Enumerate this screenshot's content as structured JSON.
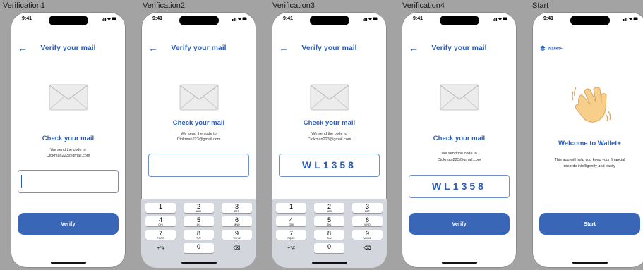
{
  "frames": [
    {
      "label": "Verification1",
      "time": "9:41",
      "nav_title": "Verify your mail",
      "check_title": "Check your mail",
      "sub_line1": "We send the code to",
      "sub_line2": "Ctokman223@gmail.com",
      "code_value": "",
      "button": "Verify"
    },
    {
      "label": "Verification2",
      "time": "9:41",
      "nav_title": "Verify your mail",
      "check_title": "Check your mail",
      "sub_line1": "We send the code to",
      "sub_line2": "Ctokman223@gmail.com",
      "code_value": ""
    },
    {
      "label": "Verification3",
      "time": "9:41",
      "nav_title": "Verify your mail",
      "check_title": "Check your mail",
      "sub_line1": "We send the code to",
      "sub_line2": "Ctokman223@gmail.com",
      "code_value": "WL1358"
    },
    {
      "label": "Verification4",
      "time": "9:41",
      "nav_title": "Verify your mail",
      "check_title": "Check your mail",
      "sub_line1": "We send the code to",
      "sub_line2": "Ctokman223@gmail.com",
      "code_value": "WL1358",
      "button": "Verify"
    },
    {
      "label": "Start",
      "time": "9:41",
      "brand": "Wallet+",
      "welcome_title": "Welcome to Wallet+",
      "welcome_line1": "This app will help you keep your financial",
      "welcome_line2": "records intelligently and easily",
      "button": "Start"
    }
  ],
  "keypad": {
    "keys": [
      {
        "digit": "1",
        "letters": ""
      },
      {
        "digit": "2",
        "letters": "ABC"
      },
      {
        "digit": "3",
        "letters": "DEF"
      },
      {
        "digit": "4",
        "letters": "GHI"
      },
      {
        "digit": "5",
        "letters": "JKL"
      },
      {
        "digit": "6",
        "letters": "MNO"
      },
      {
        "digit": "7",
        "letters": "PQRS"
      },
      {
        "digit": "8",
        "letters": "TUV"
      },
      {
        "digit": "9",
        "letters": "WXYZ"
      },
      {
        "digit": "+*#",
        "letters": ""
      },
      {
        "digit": "0",
        "letters": ""
      },
      {
        "digit": "⌫",
        "letters": ""
      }
    ]
  },
  "icons": {
    "back": "arrow-left-icon",
    "envelope": "envelope-icon",
    "wave": "waving-hand-icon",
    "logo": "wallet-logo-icon"
  },
  "colors": {
    "accent": "#2e5db3",
    "button": "#3a66b8",
    "keypad_bg": "#d4d6dd",
    "canvas": "#a3a3a3"
  }
}
